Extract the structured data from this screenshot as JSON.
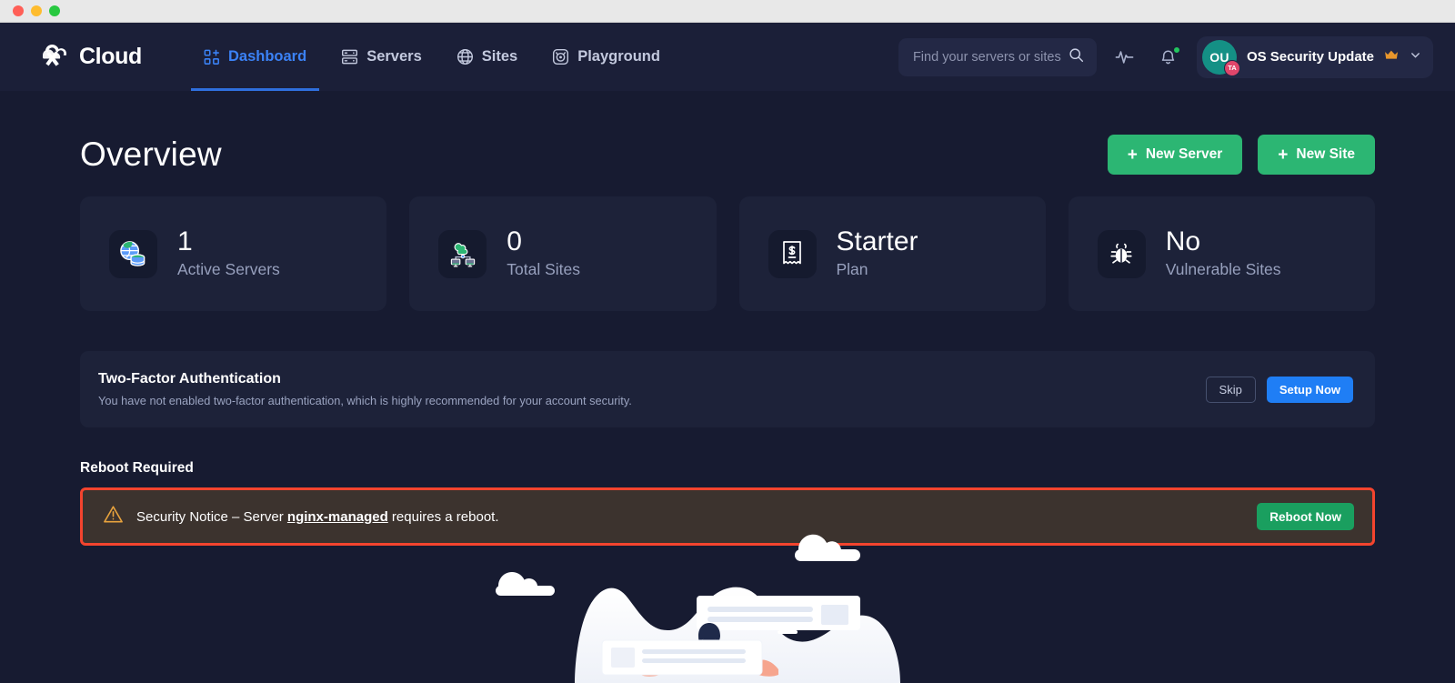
{
  "window": {
    "traffic_lights": [
      "close",
      "minimize",
      "maximize"
    ]
  },
  "topnav": {
    "brand": "Cloud",
    "links": [
      {
        "label": "Dashboard",
        "icon": "dashboard-grid-plus-icon",
        "active": true
      },
      {
        "label": "Servers",
        "icon": "server-rack-icon",
        "active": false
      },
      {
        "label": "Sites",
        "icon": "globe-icon",
        "active": false
      },
      {
        "label": "Playground",
        "icon": "playground-icon",
        "active": false
      }
    ],
    "search": {
      "placeholder": "Find your servers or sites",
      "icon": "search-icon"
    },
    "activity_icon": "activity-pulse-icon",
    "notifications_icon": "bell-icon",
    "notifications_has_unread": true,
    "user": {
      "initials": "OU",
      "badge": "TA",
      "name": "OS Security Update",
      "crown_icon": "crown-icon",
      "chevron_icon": "chevron-down-icon",
      "avatar_color": "#149085",
      "badge_color": "#e0466b"
    }
  },
  "page": {
    "title": "Overview",
    "actions": [
      {
        "label": "New Server",
        "icon": "plus-icon",
        "color": "#2cb673"
      },
      {
        "label": "New Site",
        "icon": "plus-icon",
        "color": "#2cb673"
      }
    ]
  },
  "stats": [
    {
      "value": "1",
      "label": "Active Servers",
      "icon": "globe-database-icon"
    },
    {
      "value": "0",
      "label": "Total Sites",
      "icon": "cloud-network-icon"
    },
    {
      "value": "Starter",
      "label": "Plan",
      "icon": "receipt-dollar-icon"
    },
    {
      "value": "No",
      "label": "Vulnerable Sites",
      "icon": "bug-icon"
    }
  ],
  "two_factor": {
    "title": "Two-Factor Authentication",
    "description": "You have not enabled two-factor authentication, which is highly recommended for your account security.",
    "skip_label": "Skip",
    "setup_label": "Setup Now",
    "setup_color": "#1f7ef5"
  },
  "reboot": {
    "heading": "Reboot Required",
    "alert_icon": "warning-triangle-icon",
    "text_before": "Security Notice – Server ",
    "server_name": "nginx-managed",
    "text_after": " requires a reboot.",
    "button_label": "Reboot Now",
    "button_color": "#1a9f5f",
    "highlight_border_color": "#f4442e",
    "background_color": "#3c332e"
  },
  "illustration": {
    "name": "dashboard-empty-state-illustration",
    "elements": [
      "cloud",
      "cloud",
      "cloud",
      "hill",
      "card-panel",
      "card-panel",
      "person"
    ]
  },
  "theme": {
    "app_background": "#171b31",
    "nav_background": "#1b1f38",
    "card_background": "#1d2239",
    "accent_blue": "#3b82f6",
    "accent_green": "#2cb673",
    "muted_text": "#97a0bd"
  }
}
